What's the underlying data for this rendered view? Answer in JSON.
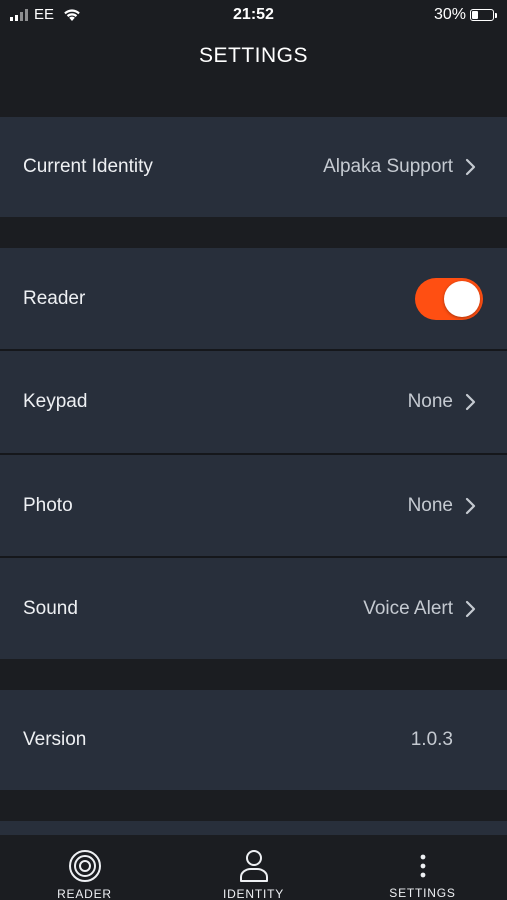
{
  "status_bar": {
    "carrier": "EE",
    "time": "21:52",
    "battery_percent": "30%",
    "battery_level": 0.3
  },
  "header": {
    "title": "SETTINGS"
  },
  "settings": {
    "current_identity": {
      "label": "Current Identity",
      "value": "Alpaka Support"
    },
    "reader": {
      "label": "Reader",
      "enabled": true
    },
    "keypad": {
      "label": "Keypad",
      "value": "None"
    },
    "photo": {
      "label": "Photo",
      "value": "None"
    },
    "sound": {
      "label": "Sound",
      "value": "Voice Alert"
    },
    "version": {
      "label": "Version",
      "value": "1.0.3"
    }
  },
  "tab_bar": {
    "tabs": [
      {
        "label": "READER",
        "icon": "target-icon"
      },
      {
        "label": "IDENTITY",
        "icon": "person-icon"
      },
      {
        "label": "SETTINGS",
        "icon": "vertical-dots-icon"
      }
    ]
  },
  "colors": {
    "background": "#1b1d21",
    "row_background": "#282f3b",
    "accent": "#ff4f12"
  }
}
